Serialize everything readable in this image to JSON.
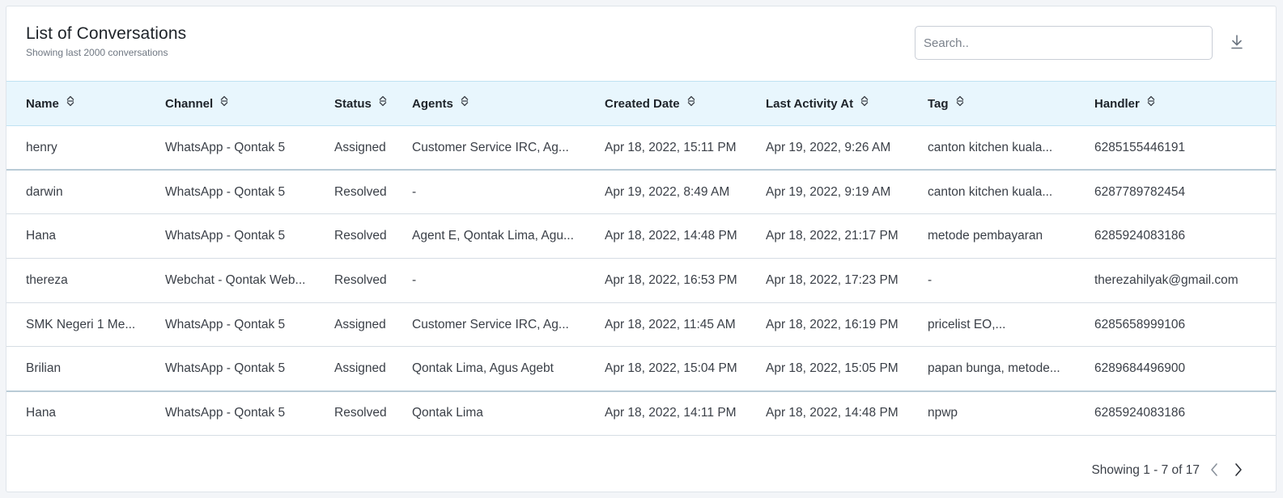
{
  "header": {
    "title": "List of Conversations",
    "subtitle": "Showing last 2000 conversations",
    "search_placeholder": "Search..",
    "download_icon": "download-icon"
  },
  "table": {
    "columns": [
      {
        "label": "Name"
      },
      {
        "label": "Channel"
      },
      {
        "label": "Status"
      },
      {
        "label": "Agents"
      },
      {
        "label": "Created Date"
      },
      {
        "label": "Last Activity At"
      },
      {
        "label": "Tag"
      },
      {
        "label": "Handler"
      }
    ],
    "rows": [
      {
        "name": "henry",
        "channel": "WhatsApp - Qontak 5",
        "status": "Assigned",
        "agents": "Customer Service IRC, Ag...",
        "created": "Apr 18, 2022, 15:11 PM",
        "last_activity": "Apr 19, 2022, 9:26 AM",
        "tag": "canton kitchen kuala...",
        "handler": "6285155446191"
      },
      {
        "name": "darwin",
        "channel": "WhatsApp - Qontak 5",
        "status": "Resolved",
        "agents": "-",
        "created": "Apr 19, 2022, 8:49 AM",
        "last_activity": "Apr 19, 2022, 9:19 AM",
        "tag": "canton kitchen kuala...",
        "handler": "6287789782454"
      },
      {
        "name": "Hana",
        "channel": "WhatsApp - Qontak 5",
        "status": "Resolved",
        "agents": "Agent E, Qontak Lima, Agu...",
        "created": "Apr 18, 2022, 14:48 PM",
        "last_activity": "Apr 18, 2022, 21:17 PM",
        "tag": "metode pembayaran",
        "handler": "6285924083186"
      },
      {
        "name": "thereza",
        "channel": "Webchat - Qontak Web...",
        "status": "Resolved",
        "agents": "-",
        "created": "Apr 18, 2022, 16:53 PM",
        "last_activity": "Apr 18, 2022, 17:23 PM",
        "tag": "-",
        "handler": "therezahilyak@gmail.com"
      },
      {
        "name": "SMK Negeri 1 Me...",
        "channel": "WhatsApp - Qontak 5",
        "status": "Assigned",
        "agents": "Customer Service IRC, Ag...",
        "created": "Apr 18, 2022, 11:45 AM",
        "last_activity": "Apr 18, 2022, 16:19 PM",
        "tag": "pricelist EO,...",
        "handler": "6285658999106"
      },
      {
        "name": "Brilian",
        "channel": "WhatsApp - Qontak 5",
        "status": "Assigned",
        "agents": "Qontak Lima, Agus Agebt",
        "created": "Apr 18, 2022, 15:04 PM",
        "last_activity": "Apr 18, 2022, 15:05 PM",
        "tag": "papan bunga, metode...",
        "handler": "6289684496900"
      },
      {
        "name": "Hana",
        "channel": "WhatsApp - Qontak 5",
        "status": "Resolved",
        "agents": "Qontak Lima",
        "created": "Apr 18, 2022, 14:11 PM",
        "last_activity": "Apr 18, 2022, 14:48 PM",
        "tag": "npwp",
        "handler": "6285924083186"
      }
    ]
  },
  "pagination": {
    "text": "Showing 1 - 7 of 17",
    "prev_icon": "chevron-left-icon",
    "next_icon": "chevron-right-icon"
  }
}
